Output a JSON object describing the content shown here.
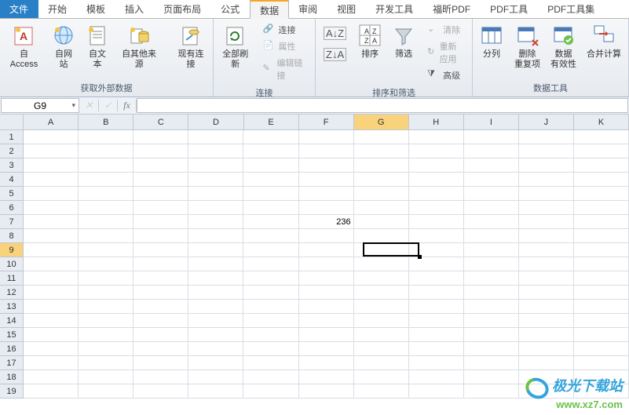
{
  "tabs": {
    "file": "文件",
    "items": [
      "开始",
      "模板",
      "插入",
      "页面布局",
      "公式",
      "数据",
      "审阅",
      "视图",
      "开发工具",
      "福昕PDF",
      "PDF工具",
      "PDF工具集"
    ],
    "active_index": 5
  },
  "ribbon": {
    "groups": [
      {
        "label": "获取外部数据",
        "buttons": [
          "自 Access",
          "自网站",
          "自文本",
          "自其他来源",
          "现有连接"
        ]
      },
      {
        "label": "连接",
        "refresh": "全部刷新",
        "items": [
          "连接",
          "属性",
          "编辑链接"
        ]
      },
      {
        "label": "排序和筛选",
        "sort": "排序",
        "filter": "筛选",
        "items": [
          "清除",
          "重新应用",
          "高级"
        ]
      },
      {
        "label": "数据工具",
        "buttons": [
          "分列",
          "删除\n重复项",
          "数据\n有效性",
          "合并计算"
        ]
      }
    ]
  },
  "namebox": "G9",
  "formula": "",
  "grid": {
    "columns": [
      "A",
      "B",
      "C",
      "D",
      "E",
      "F",
      "G",
      "H",
      "I",
      "J",
      "K"
    ],
    "rows": 19,
    "active_col_index": 6,
    "active_row": 9,
    "cells": {
      "F7": "236"
    }
  },
  "watermark": {
    "line1": "极光下载站",
    "line2": "www.xz7.com"
  }
}
